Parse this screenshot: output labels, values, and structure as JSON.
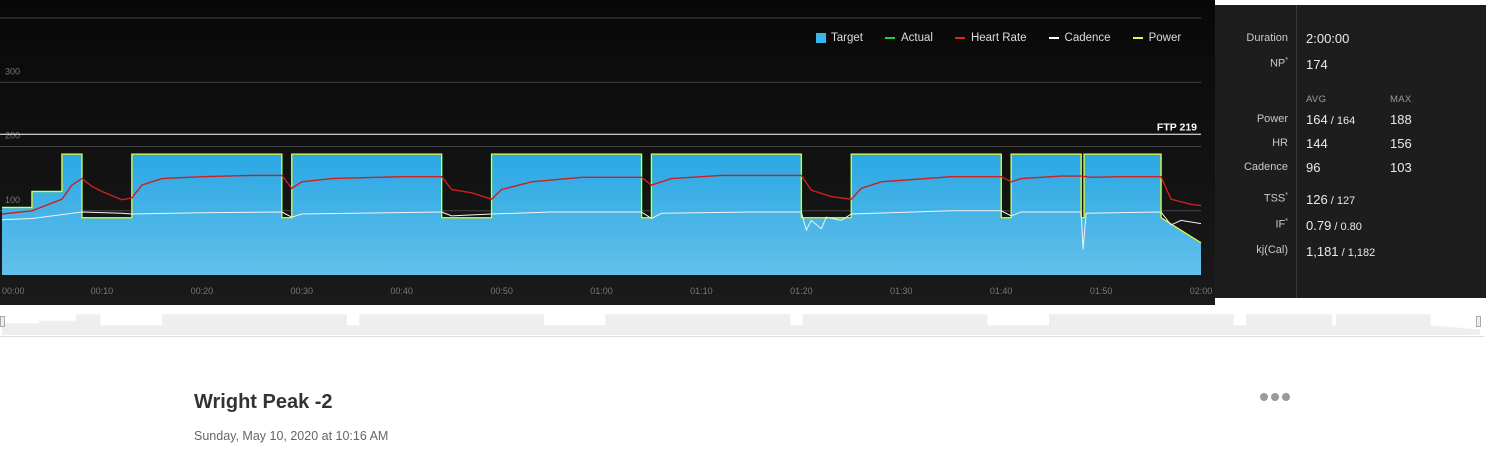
{
  "chart": {
    "legend": [
      {
        "label": "Target",
        "color": "#3ab4ea",
        "kind": "box"
      },
      {
        "label": "Actual",
        "color": "#22cc44",
        "kind": "line"
      },
      {
        "label": "Heart Rate",
        "color": "#dd2222",
        "kind": "line"
      },
      {
        "label": "Cadence",
        "color": "#ffffff",
        "kind": "line"
      },
      {
        "label": "Power",
        "color": "#eef060",
        "kind": "line"
      }
    ],
    "y_ticks": [
      {
        "label": "300",
        "value": 300
      },
      {
        "label": "200",
        "value": 200
      },
      {
        "label": "100",
        "value": 100
      }
    ],
    "ftp_label": "FTP 219",
    "x_ticks": [
      "00:00",
      "00:10",
      "00:20",
      "00:30",
      "00:40",
      "00:50",
      "01:00",
      "01:10",
      "01:20",
      "01:30",
      "01:40",
      "01:50",
      "02:00"
    ]
  },
  "chart_data": {
    "type": "area",
    "x_unit": "minutes",
    "xlim": [
      0,
      120
    ],
    "ylim": [
      0,
      400
    ],
    "ftp": 219,
    "target_power": [
      [
        0,
        105
      ],
      [
        3,
        105
      ],
      [
        3,
        130
      ],
      [
        6,
        130
      ],
      [
        6,
        188
      ],
      [
        8,
        188
      ],
      [
        8,
        89
      ],
      [
        13,
        89
      ],
      [
        13,
        188
      ],
      [
        28,
        188
      ],
      [
        28,
        89
      ],
      [
        29,
        89
      ],
      [
        29,
        188
      ],
      [
        44,
        188
      ],
      [
        44,
        89
      ],
      [
        49,
        89
      ],
      [
        49,
        188
      ],
      [
        64,
        188
      ],
      [
        64,
        89
      ],
      [
        65,
        89
      ],
      [
        65,
        188
      ],
      [
        80,
        188
      ],
      [
        80,
        89
      ],
      [
        85,
        89
      ],
      [
        85,
        188
      ],
      [
        100,
        188
      ],
      [
        100,
        89
      ],
      [
        101,
        89
      ],
      [
        101,
        188
      ],
      [
        108,
        188
      ],
      [
        108,
        89
      ],
      [
        108.3,
        89
      ],
      [
        108.3,
        188
      ],
      [
        116,
        188
      ],
      [
        116,
        89
      ],
      [
        120,
        50
      ]
    ],
    "heart_rate": [
      [
        0,
        95
      ],
      [
        3,
        100
      ],
      [
        6,
        118
      ],
      [
        7,
        140
      ],
      [
        8,
        150
      ],
      [
        9,
        138
      ],
      [
        10,
        130
      ],
      [
        12,
        117
      ],
      [
        13,
        120
      ],
      [
        14,
        140
      ],
      [
        16,
        150
      ],
      [
        20,
        153
      ],
      [
        25,
        155
      ],
      [
        28,
        155
      ],
      [
        29,
        135
      ],
      [
        30,
        145
      ],
      [
        33,
        150
      ],
      [
        40,
        153
      ],
      [
        44,
        153
      ],
      [
        45,
        133
      ],
      [
        47,
        128
      ],
      [
        49,
        118
      ],
      [
        50,
        133
      ],
      [
        53,
        145
      ],
      [
        58,
        152
      ],
      [
        64,
        152
      ],
      [
        65,
        140
      ],
      [
        67,
        150
      ],
      [
        72,
        155
      ],
      [
        80,
        155
      ],
      [
        81,
        132
      ],
      [
        83,
        122
      ],
      [
        85,
        118
      ],
      [
        86,
        135
      ],
      [
        88,
        145
      ],
      [
        95,
        153
      ],
      [
        100,
        153
      ],
      [
        101,
        145
      ],
      [
        102,
        150
      ],
      [
        106,
        154
      ],
      [
        108,
        154
      ],
      [
        109,
        152
      ],
      [
        112,
        153
      ],
      [
        116,
        153
      ],
      [
        117,
        118
      ],
      [
        119,
        110
      ],
      [
        120,
        108
      ]
    ],
    "cadence": [
      [
        0,
        86
      ],
      [
        3,
        88
      ],
      [
        6,
        94
      ],
      [
        8,
        98
      ],
      [
        12,
        96
      ],
      [
        13,
        95
      ],
      [
        20,
        97
      ],
      [
        28,
        98
      ],
      [
        29,
        90
      ],
      [
        30,
        95
      ],
      [
        44,
        98
      ],
      [
        45,
        92
      ],
      [
        49,
        95
      ],
      [
        55,
        98
      ],
      [
        64,
        98
      ],
      [
        65,
        88
      ],
      [
        66,
        96
      ],
      [
        75,
        98
      ],
      [
        80,
        98
      ],
      [
        80.5,
        70
      ],
      [
        81,
        85
      ],
      [
        82,
        72
      ],
      [
        82.5,
        90
      ],
      [
        84,
        85
      ],
      [
        85,
        95
      ],
      [
        95,
        100
      ],
      [
        100,
        100
      ],
      [
        101,
        92
      ],
      [
        102,
        98
      ],
      [
        108,
        98
      ],
      [
        108.2,
        40
      ],
      [
        108.5,
        96
      ],
      [
        116,
        98
      ],
      [
        117,
        78
      ],
      [
        118,
        85
      ],
      [
        120,
        80
      ]
    ],
    "ftp_label": "FTP 219",
    "x_ticks": [
      "00:00",
      "00:10",
      "00:20",
      "00:30",
      "00:40",
      "00:50",
      "01:00",
      "01:10",
      "01:20",
      "01:30",
      "01:40",
      "01:50",
      "02:00"
    ],
    "y_ticks": [
      100,
      200,
      300
    ],
    "series": [
      {
        "name": "Target"
      },
      {
        "name": "Actual"
      },
      {
        "name": "Heart Rate"
      },
      {
        "name": "Cadence"
      },
      {
        "name": "Power"
      }
    ]
  },
  "stats": {
    "duration_label": "Duration",
    "duration_value": "2:00:00",
    "np_label": "NP",
    "np_value": "174",
    "avg_head": "AVG",
    "max_head": "MAX",
    "power_label": "Power",
    "power_avg": "164",
    "power_avg2": "164",
    "power_max": "188",
    "hr_label": "HR",
    "hr_avg": "144",
    "hr_max": "156",
    "cadence_label": "Cadence",
    "cadence_avg": "96",
    "cadence_max": "103",
    "tss_label": "TSS",
    "tss_value": "126",
    "tss_value2": "127",
    "if_label": "IF",
    "if_value": "0.79",
    "if_value2": "0.80",
    "kj_label": "kj(Cal)",
    "kj_value": "1,181",
    "kj_value2": "1,182",
    "sup_mark": "*",
    "slash": " / "
  },
  "workout": {
    "title": "Wright Peak -2",
    "date": "Sunday, May 10, 2020 at 10:16 AM",
    "menu_icon": "ellipsis-icon"
  }
}
